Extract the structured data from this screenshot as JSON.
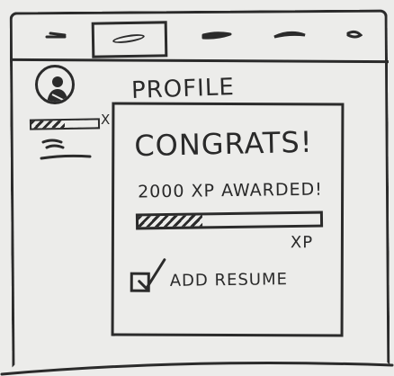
{
  "navbar": {
    "items": [
      {
        "name": "nav-left"
      },
      {
        "name": "nav-active"
      },
      {
        "name": "nav-3"
      },
      {
        "name": "nav-4"
      },
      {
        "name": "nav-5"
      }
    ]
  },
  "page": {
    "title": "PROFILE",
    "xp_small_label": "XP",
    "xp_small_progress": 0.5
  },
  "modal": {
    "title": "CONGRATS!",
    "subtitle": "2000 XP AWARDED!",
    "xp_label": "XP",
    "progress": 0.35,
    "checkbox_label": "ADD RESUME",
    "checkbox_checked": true
  },
  "icons": {
    "avatar": "user-avatar-icon",
    "check": "checkmark-icon"
  }
}
